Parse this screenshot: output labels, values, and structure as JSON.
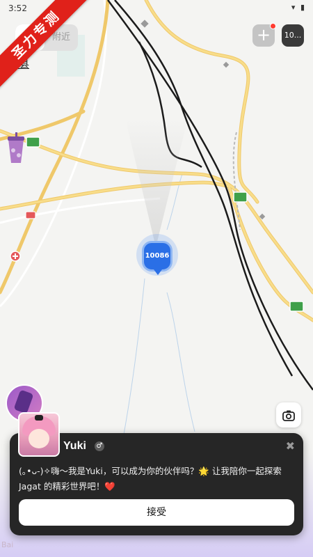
{
  "status_bar": {
    "time": "3:52",
    "icons": "▾ ▮"
  },
  "ribbon": {
    "text": "圣力专测"
  },
  "header": {
    "tab_nearby": "附近",
    "add_button": "+",
    "message_button": "10..."
  },
  "map": {
    "county_label": "榆中县",
    "user_marker_label": "10086"
  },
  "camera": {
    "icon": "📷"
  },
  "card": {
    "name": "Yuki",
    "gender_symbol": "♂",
    "close_symbol": "✖",
    "message": "(｡•ᴗ-)✧嗨～我是Yuki，可以成为你的伙伴吗？🌟 让我陪你一起探索 Jagat 的精彩世界吧！❤️",
    "accept_label": "接受"
  },
  "watermark": {
    "text": "Bai"
  },
  "colors": {
    "marker_blue": "#2a6fe6",
    "road_yellow": "#f6d66e",
    "ribbon_red": "#e0211a",
    "card_bg": "#262626"
  }
}
